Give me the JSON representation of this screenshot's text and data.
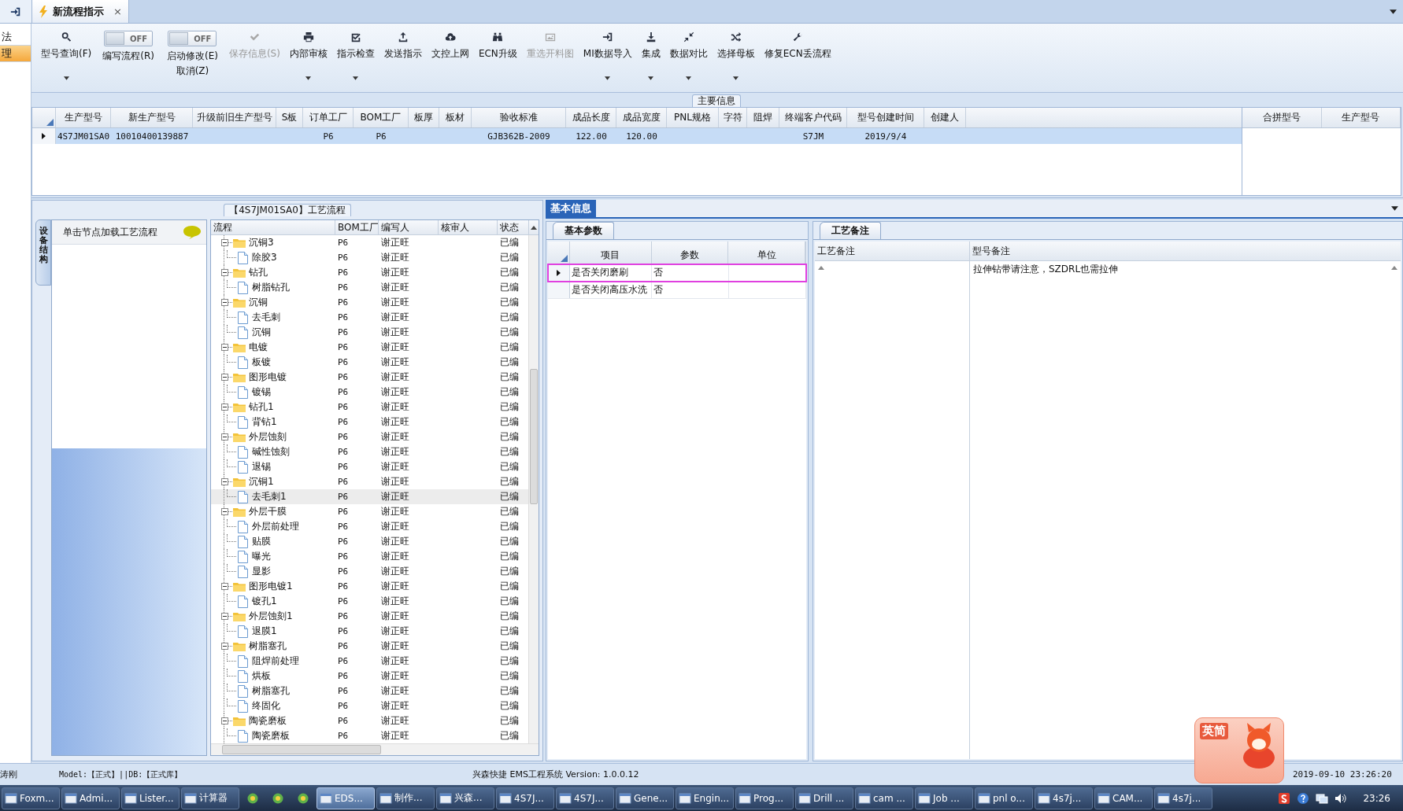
{
  "app_tab": {
    "title": "新流程指示",
    "close": "×"
  },
  "side_strip": [
    {
      "label": "法",
      "selected": false
    },
    {
      "label": "理",
      "selected": true
    }
  ],
  "toolbar": [
    {
      "kind": "button",
      "label": "型号查询(F)",
      "dropdown": true,
      "disabled": false
    },
    {
      "kind": "toggle",
      "switch": "OFF",
      "on": false,
      "label": "编写流程(R)"
    },
    {
      "kind": "toggle",
      "switch": "OFF",
      "on": false,
      "label": "启动修改(E)",
      "label_2": "取消(Z)"
    },
    {
      "kind": "button",
      "label": "保存信息(S)",
      "dropdown": false,
      "disabled": true
    },
    {
      "kind": "button",
      "label": "内部审核",
      "dropdown": true,
      "disabled": false
    },
    {
      "kind": "button",
      "label": "指示检查",
      "dropdown": true,
      "disabled": false
    },
    {
      "kind": "button",
      "label": "发送指示",
      "dropdown": false,
      "disabled": false
    },
    {
      "kind": "button",
      "label": "文控上网",
      "dropdown": false,
      "disabled": false
    },
    {
      "kind": "button",
      "label": "ECN升级",
      "dropdown": false,
      "disabled": false
    },
    {
      "kind": "button",
      "label": "重选开料图",
      "dropdown": false,
      "disabled": true
    },
    {
      "kind": "button",
      "label": "MI数据导入",
      "dropdown": true,
      "disabled": false
    },
    {
      "kind": "button",
      "label": "集成",
      "dropdown": true,
      "disabled": false
    },
    {
      "kind": "button",
      "label": "数据对比",
      "dropdown": true,
      "disabled": false
    },
    {
      "kind": "button",
      "label": "选择母板",
      "dropdown": true,
      "disabled": false
    },
    {
      "kind": "button",
      "label": "修复ECN丢流程",
      "dropdown": false,
      "disabled": false
    }
  ],
  "main_info": {
    "title": "主要信息",
    "columns": [
      "生产型号",
      "新生产型号",
      "升级前旧生产型号",
      "S板",
      "订单工厂",
      "BOM工厂",
      "板厚",
      "板材",
      "验收标准",
      "成品长度",
      "成品宽度",
      "PNL规格",
      "字符",
      "阻焊",
      "终端客户代码",
      "型号创建时间",
      "创建人"
    ],
    "rows": [
      {
        "selected": true,
        "cells": [
          "4S7JM01SA0",
          "10010400139887",
          null,
          null,
          "P6",
          "P6",
          null,
          null,
          "GJB362B-2009",
          "122.00",
          "120.00",
          null,
          null,
          null,
          "S7JM",
          "2019/9/4",
          null
        ]
      }
    ]
  },
  "merge_table": {
    "columns": [
      "合拼型号",
      "生产型号"
    ]
  },
  "process_flow": {
    "title": "【4S7JM01SA0】工艺流程",
    "side_tab": "设备结构",
    "hint": "单击节点加载工艺流程",
    "columns": [
      "流程",
      "BOM工厂",
      "编写人",
      "核审人",
      "状态"
    ],
    "rows": [
      {
        "name": "沉铜3",
        "bom": "P6",
        "writer": "谢正旺",
        "status": "已编",
        "expanded": true,
        "selected": false,
        "children": [
          {
            "name": "除胶3",
            "bom": "P6",
            "writer": "谢正旺",
            "status": "已编",
            "selected": false
          }
        ]
      },
      {
        "name": "钻孔",
        "bom": "P6",
        "writer": "谢正旺",
        "status": "已编",
        "expanded": true,
        "selected": false,
        "children": [
          {
            "name": "树脂钻孔",
            "bom": "P6",
            "writer": "谢正旺",
            "status": "已编",
            "selected": false
          }
        ]
      },
      {
        "name": "沉铜",
        "bom": "P6",
        "writer": "谢正旺",
        "status": "已编",
        "expanded": true,
        "selected": false,
        "children": [
          {
            "name": "去毛刺",
            "bom": "P6",
            "writer": "谢正旺",
            "status": "已编",
            "selected": false
          },
          {
            "name": "沉铜",
            "bom": "P6",
            "writer": "谢正旺",
            "status": "已编",
            "selected": false
          }
        ]
      },
      {
        "name": "电镀",
        "bom": "P6",
        "writer": "谢正旺",
        "status": "已编",
        "expanded": true,
        "selected": false,
        "children": [
          {
            "name": "板镀",
            "bom": "P6",
            "writer": "谢正旺",
            "status": "已编",
            "selected": false
          }
        ]
      },
      {
        "name": "图形电镀",
        "bom": "P6",
        "writer": "谢正旺",
        "status": "已编",
        "expanded": true,
        "selected": false,
        "children": [
          {
            "name": "镀锡",
            "bom": "P6",
            "writer": "谢正旺",
            "status": "已编",
            "selected": false
          }
        ]
      },
      {
        "name": "钻孔1",
        "bom": "P6",
        "writer": "谢正旺",
        "status": "已编",
        "expanded": true,
        "selected": false,
        "children": [
          {
            "name": "背钻1",
            "bom": "P6",
            "writer": "谢正旺",
            "status": "已编",
            "selected": false
          }
        ]
      },
      {
        "name": "外层蚀刻",
        "bom": "P6",
        "writer": "谢正旺",
        "status": "已编",
        "expanded": true,
        "selected": false,
        "children": [
          {
            "name": "碱性蚀刻",
            "bom": "P6",
            "writer": "谢正旺",
            "status": "已编",
            "selected": false
          },
          {
            "name": "退锡",
            "bom": "P6",
            "writer": "谢正旺",
            "status": "已编",
            "selected": false
          }
        ]
      },
      {
        "name": "沉铜1",
        "bom": "P6",
        "writer": "谢正旺",
        "status": "已编",
        "expanded": true,
        "selected": false,
        "children": [
          {
            "name": "去毛刺1",
            "bom": "P6",
            "writer": "谢正旺",
            "status": "已编",
            "selected": true
          }
        ]
      },
      {
        "name": "外层干膜",
        "bom": "P6",
        "writer": "谢正旺",
        "status": "已编",
        "expanded": true,
        "selected": false,
        "children": [
          {
            "name": "外层前处理",
            "bom": "P6",
            "writer": "谢正旺",
            "status": "已编",
            "selected": false
          },
          {
            "name": "贴膜",
            "bom": "P6",
            "writer": "谢正旺",
            "status": "已编",
            "selected": false
          },
          {
            "name": "曝光",
            "bom": "P6",
            "writer": "谢正旺",
            "status": "已编",
            "selected": false
          },
          {
            "name": "显影",
            "bom": "P6",
            "writer": "谢正旺",
            "status": "已编",
            "selected": false
          }
        ]
      },
      {
        "name": "图形电镀1",
        "bom": "P6",
        "writer": "谢正旺",
        "status": "已编",
        "expanded": true,
        "selected": false,
        "children": [
          {
            "name": "镀孔1",
            "bom": "P6",
            "writer": "谢正旺",
            "status": "已编",
            "selected": false
          }
        ]
      },
      {
        "name": "外层蚀刻1",
        "bom": "P6",
        "writer": "谢正旺",
        "status": "已编",
        "expanded": true,
        "selected": false,
        "children": [
          {
            "name": "退膜1",
            "bom": "P6",
            "writer": "谢正旺",
            "status": "已编",
            "selected": false
          }
        ]
      },
      {
        "name": "树脂塞孔",
        "bom": "P6",
        "writer": "谢正旺",
        "status": "已编",
        "expanded": true,
        "selected": false,
        "children": [
          {
            "name": "阻焊前处理",
            "bom": "P6",
            "writer": "谢正旺",
            "status": "已编",
            "selected": false
          },
          {
            "name": "烘板",
            "bom": "P6",
            "writer": "谢正旺",
            "status": "已编",
            "selected": false
          },
          {
            "name": "树脂塞孔",
            "bom": "P6",
            "writer": "谢正旺",
            "status": "已编",
            "selected": false
          },
          {
            "name": "终固化",
            "bom": "P6",
            "writer": "谢正旺",
            "status": "已编",
            "selected": false
          }
        ]
      },
      {
        "name": "陶瓷磨板",
        "bom": "P6",
        "writer": "谢正旺",
        "status": "已编",
        "expanded": true,
        "selected": false,
        "children": [
          {
            "name": "陶瓷磨板",
            "bom": "P6",
            "writer": "谢正旺",
            "status": "已编",
            "selected": false
          }
        ]
      }
    ]
  },
  "basic_info": {
    "title": "基本信息",
    "params": {
      "tab": "基本参数",
      "columns": [
        "项目",
        "参数",
        "单位"
      ],
      "rows": [
        {
          "item": "是否关闭磨刷",
          "value": "否",
          "selected": true
        },
        {
          "item": "是否关闭高压水洗",
          "value": "否",
          "selected": false
        }
      ]
    },
    "remarks": {
      "tab": "工艺备注",
      "columns": [
        "工艺备注",
        "型号备注"
      ],
      "model_note": "拉伸钻带请注意，SZDRL也需拉伸"
    }
  },
  "status_bar": {
    "user": "涛刚",
    "model": "Model:【正式】||DB:【正式库】",
    "system": "兴森快捷 EMS工程系统 Version: 1.0.0.12",
    "datetime": "2019-09-10 23:26:20"
  },
  "ime_widget": {
    "label": "英简"
  },
  "taskbar": {
    "items": [
      {
        "kind": "app",
        "label": "Foxm...",
        "selected": false
      },
      {
        "kind": "app",
        "label": "Admi...",
        "selected": false
      },
      {
        "kind": "app",
        "label": "Lister...",
        "selected": false
      },
      {
        "kind": "app",
        "label": "计算器",
        "selected": false
      },
      {
        "kind": "icon",
        "selected": false
      },
      {
        "kind": "icon",
        "selected": false
      },
      {
        "kind": "icon",
        "selected": false
      },
      {
        "kind": "app",
        "label": "EDS...",
        "selected": true
      },
      {
        "kind": "app",
        "label": "制作...",
        "selected": false
      },
      {
        "kind": "app",
        "label": "兴森...",
        "selected": false
      },
      {
        "kind": "app",
        "label": "4S7J...",
        "selected": false
      },
      {
        "kind": "app",
        "label": "4S7J...",
        "selected": false
      },
      {
        "kind": "app",
        "label": "Gene...",
        "selected": false
      },
      {
        "kind": "app",
        "label": "Engin...",
        "selected": false
      },
      {
        "kind": "app",
        "label": "Prog...",
        "selected": false
      },
      {
        "kind": "app",
        "label": "Drill ...",
        "selected": false
      },
      {
        "kind": "app",
        "label": "cam ...",
        "selected": false
      },
      {
        "kind": "app",
        "label": "Job ...",
        "selected": false
      },
      {
        "kind": "app",
        "label": "pnl o...",
        "selected": false
      },
      {
        "kind": "app",
        "label": "4s7j...",
        "selected": false
      },
      {
        "kind": "app",
        "label": "CAM...",
        "selected": false
      },
      {
        "kind": "app",
        "label": "4s7j...",
        "selected": false
      }
    ],
    "time": "23:26"
  }
}
